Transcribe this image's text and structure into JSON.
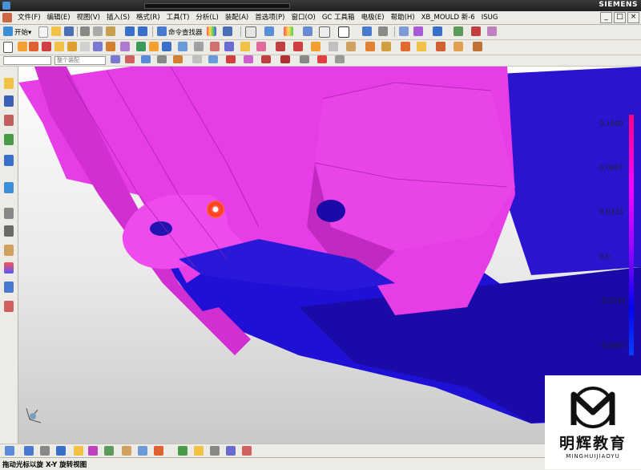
{
  "window": {
    "brand": "SIEMENS"
  },
  "menu": [
    "文件(F)",
    "编辑(E)",
    "视图(V)",
    "插入(S)",
    "格式(R)",
    "工具(T)",
    "分析(L)",
    "装配(A)",
    "首选项(P)",
    "窗口(O)",
    "GC 工具箱",
    "电极(E)",
    "帮助(H)",
    "XB_MOULD 新-6",
    "ISUG"
  ],
  "window_buttons": [
    "_",
    "□",
    "×"
  ],
  "toolbar": {
    "start_label": "开始▾",
    "command_finder": "命令查找器"
  },
  "filter_dropdown": "整个装配",
  "color_scale": {
    "labels": [
      "0.1000",
      "0.0667",
      "0.0333",
      "0.0",
      "-0.0333",
      "-0.0667"
    ],
    "colors": [
      "#ff0080",
      "#ff00ff",
      "#a000ff",
      "#0000ff"
    ]
  },
  "status": {
    "text": "拖动光标以旋 X-Y 旋转视图"
  },
  "watermark": {
    "cn": "明辉教育",
    "pinyin": "MINGHUIJIAOYU"
  },
  "colors": {
    "face_magenta": "#e63de6",
    "face_blue": "#1f10d6",
    "dark_blue": "#1a0aa8"
  }
}
